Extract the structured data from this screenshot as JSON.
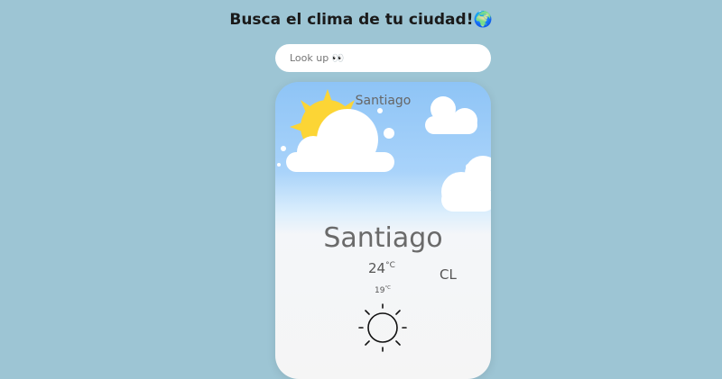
{
  "header": {
    "title": "Busca el clima de tu ciudad!🌍"
  },
  "search": {
    "placeholder": "Look up 👀",
    "value": ""
  },
  "card": {
    "city_top": "Santiago",
    "city": "Santiago",
    "temp": "24",
    "temp_unit": "°C",
    "country": "CL",
    "min_temp": "19",
    "min_unit": "°C",
    "weather_icon": "sun-icon"
  },
  "colors": {
    "background": "#9dc5d4",
    "sky": "#8ec4f6",
    "sun": "#fcd535"
  }
}
